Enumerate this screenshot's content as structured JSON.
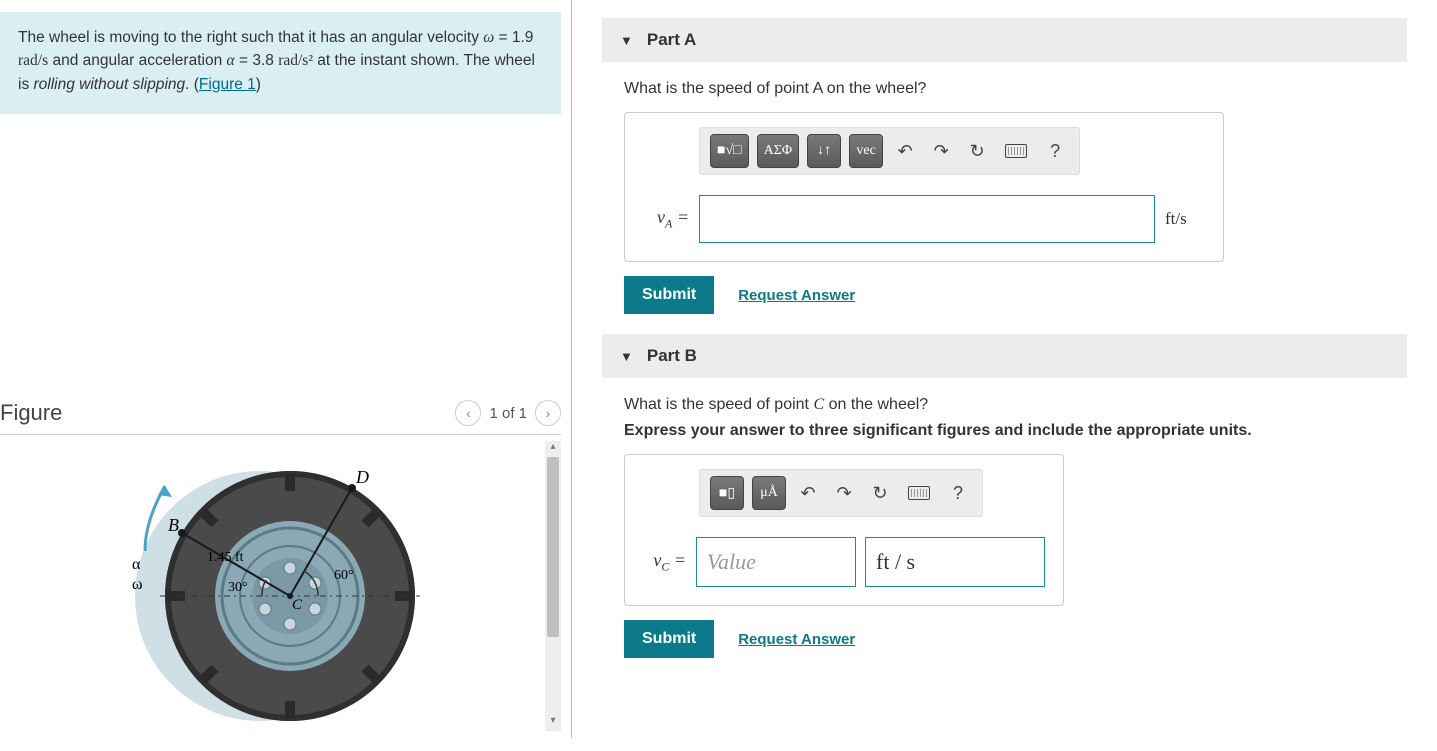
{
  "problem": {
    "text_pre": "The wheel is moving to the right such that it has an angular velocity ",
    "omega_sym": "ω",
    "omega_eq": " = 1.9 ",
    "omega_unit": "rad/s",
    "text_mid": " and angular acceleration ",
    "alpha_sym": "α",
    "alpha_eq": " = 3.8 ",
    "alpha_unit": "rad/s²",
    "text_post": " at the instant shown. The wheel is ",
    "emph": "rolling without slipping",
    "text_end": ". (",
    "figure_link": "Figure 1",
    "paren_close": ")"
  },
  "figure": {
    "title": "Figure",
    "nav": "1 of 1",
    "labels": {
      "B": "B",
      "D": "D",
      "C": "C",
      "alpha": "α",
      "omega": "ω",
      "radius": "1.45 ft",
      "angle30": "30°",
      "angle60": "60°"
    }
  },
  "partA": {
    "title": "Part A",
    "question": "What is the speed of point A on the wheel?",
    "var_label_html": "v<sub>A</sub> =",
    "unit": "ft/s",
    "toolbar": {
      "templates": "■√□",
      "greek": "ΑΣΦ",
      "subsup": "↓↑",
      "vec": "vec",
      "undo": "↶",
      "redo": "↷",
      "reset": "↻",
      "help": "?"
    },
    "submit": "Submit",
    "request": "Request Answer"
  },
  "partB": {
    "title": "Part B",
    "question_pre": "What is the speed of point ",
    "question_var": "C",
    "question_post": " on the wheel?",
    "subtext": "Express your answer to three significant figures and include the appropriate units.",
    "var_label_html": "v<sub>C</sub> =",
    "value_placeholder": "Value",
    "unit_value": "ft / s",
    "toolbar": {
      "templates": "■▯",
      "units": "μÅ",
      "undo": "↶",
      "redo": "↷",
      "reset": "↻",
      "help": "?"
    },
    "submit": "Submit",
    "request": "Request Answer"
  }
}
